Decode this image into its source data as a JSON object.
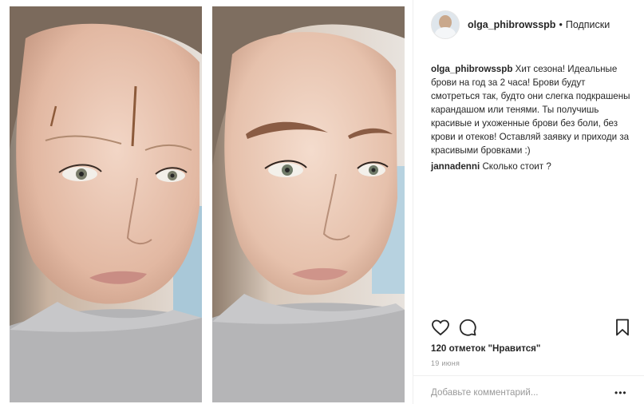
{
  "header": {
    "username": "olga_phibrowsspb",
    "separator": "•",
    "follow_label": "Подписки"
  },
  "photo": {
    "before_alt": "before-photo",
    "after_alt": "after-photo"
  },
  "comments": [
    {
      "user": "olga_phibrowsspb",
      "text": "Хит сезона! Идеальные брови на год за 2 часа! Брови будут смотреться так, будто они слегка подкрашены карандашом или тенями. Ты получишь красивые и ухоженные брови без боли, без крови и отеков! Оставляй заявку и приходи за красивыми бровками :)"
    },
    {
      "user": "jannadenni",
      "text": "Сколько стоит ?"
    }
  ],
  "actions": {
    "like_icon": "heart-icon",
    "comment_icon": "comment-icon",
    "save_icon": "bookmark-icon"
  },
  "likes_text": "120 отметок \"Нравится\"",
  "date_text": "19 июня",
  "add_comment_placeholder": "Добавьте комментарий...",
  "more_label": "•••",
  "colors": {
    "text": "#262626",
    "muted": "#999999",
    "border": "#efefef"
  }
}
